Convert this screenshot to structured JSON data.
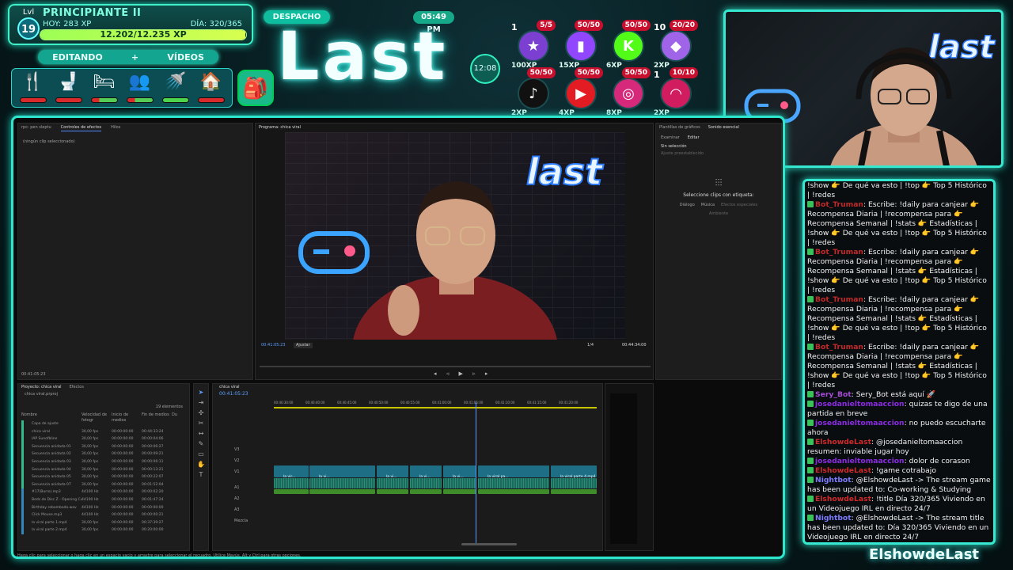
{
  "level": {
    "lvl_label": "Lvl",
    "lvl_value": "19",
    "rank": "PRINCIPIANTE II",
    "hoy": "HOY: 283 XP",
    "dia": "DÍA: 320/365",
    "xp": "12.202/12.235 XP",
    "xp_progress": 0.997
  },
  "mode": {
    "left": "EDITANDO",
    "sep": "+",
    "right": "VÍDEOS"
  },
  "needs": [
    {
      "icon": "fork-knife-icon",
      "glyph": "🍴",
      "level": "low"
    },
    {
      "icon": "toilet-icon",
      "glyph": "🚽",
      "level": "low"
    },
    {
      "icon": "bed-icon",
      "glyph": "🛏",
      "level": "mid"
    },
    {
      "icon": "people-icon",
      "glyph": "👥",
      "level": "mid"
    },
    {
      "icon": "shower-icon",
      "glyph": "🚿",
      "level": "full"
    },
    {
      "icon": "house-icon",
      "glyph": "🏠",
      "level": "low"
    }
  ],
  "title": {
    "despacho": "DESPACHO",
    "clock": "05:49 PM",
    "logo": "Last",
    "timer": "12:08"
  },
  "socials": [
    {
      "name": "star-icon",
      "glyph": "★",
      "count": "5/5",
      "index": "1",
      "xp": "100XP",
      "color": "#7b3fd1"
    },
    {
      "name": "twitch-icon",
      "glyph": "▮",
      "count": "50/50",
      "index": "",
      "xp": "15XP",
      "color": "#9146ff"
    },
    {
      "name": "kick-icon",
      "glyph": "K",
      "count": "50/50",
      "index": "",
      "xp": "6XP",
      "color": "#53fc18"
    },
    {
      "name": "ethereum-icon",
      "glyph": "◆",
      "count": "20/20",
      "index": "10",
      "xp": "2XP",
      "color": "#a064e8"
    },
    {
      "name": "tiktok-icon",
      "glyph": "♪",
      "count": "50/50",
      "index": "",
      "xp": "2XP",
      "color": "#111111"
    },
    {
      "name": "youtube-icon",
      "glyph": "▶",
      "count": "50/50",
      "index": "",
      "xp": "4XP",
      "color": "#e31b23"
    },
    {
      "name": "instagram-icon",
      "glyph": "◎",
      "count": "50/50",
      "index": "",
      "xp": "8XP",
      "color": "#d6297c"
    },
    {
      "name": "signal-icon",
      "glyph": "◠",
      "count": "10/10",
      "index": "1",
      "xp": "2XP",
      "color": "#d11d5f"
    }
  ],
  "editor": {
    "tabs_left": [
      "rpc: pen sleptu",
      "Controles de efectos",
      "Hilos"
    ],
    "no_clip": "(ningún clip seleccionado)",
    "left_time": "00:41:05:23",
    "program_tab": "Programa: chica viral",
    "program_time": "00:41:05:23",
    "fit": "Ajustar",
    "ratio": "1/4",
    "duration": "00:44:34:00",
    "right_tabs": [
      "Plantillas de gráficos",
      "Sonido esencial"
    ],
    "right_sub": [
      "Examinar",
      "Editar"
    ],
    "sin_seleccion": "Sin selección",
    "ajuste": "Ajuste preestablecido",
    "select_clips": "Seleccione clips con etiqueta:",
    "tags": [
      "Diálogo",
      "Música",
      "Efectos especiales"
    ],
    "ambiente": "Ambiente",
    "project_tabs": [
      "Proyecto: chica viral",
      "Efectos"
    ],
    "project_file": "chica viral.prproj",
    "items_count": "19 elementos",
    "columns": [
      "Nombre",
      "Velocidad de fotogr",
      "Inicio de medios",
      "Fin de medios",
      "Du"
    ],
    "rows": [
      [
        "Capa de ajuste",
        "",
        "",
        ""
      ],
      [
        "chica viral",
        "30,00 fps",
        "00:00:00:00",
        "00:44:33:24"
      ],
      [
        "IAP Sunofbline",
        "30,00 fps",
        "00:00:00:00",
        "00:00:04:06"
      ],
      [
        "Secuencia anidada 01",
        "30,00 fps",
        "00:00:00:00",
        "00:00:06:27"
      ],
      [
        "Secuencia anidada 02",
        "30,00 fps",
        "00:00:00:00",
        "00:00:09:21"
      ],
      [
        "Secuencia anidada 03",
        "30,00 fps",
        "00:00:00:00",
        "00:00:06:11"
      ],
      [
        "Secuencia anidada 04",
        "30,00 fps",
        "00:00:00:00",
        "00:00:13:21"
      ],
      [
        "Secuencia anidada 05",
        "30,00 fps",
        "00:00:00:00",
        "00:00:22:07"
      ],
      [
        "Secuencia anidada 07",
        "30,00 fps",
        "00:00:00:00",
        "00:01:52:04"
      ],
      [
        "#17(Burro).mp3",
        "44100 Hz",
        "00:00:00:00",
        "00:00:02:20"
      ],
      [
        "Beds de Disc Z - Opening Cut",
        "44100 Hz",
        "00:00:00:00",
        "00:01:47:24"
      ],
      [
        "Birthday rebombado.wav",
        "44100 Hz",
        "00:00:00:00",
        "00:00:00:00"
      ],
      [
        "Click Mouse.mp3",
        "44100 Hz",
        "00:00:00:00",
        "00:00:00:21"
      ],
      [
        "la viral parte 1.mp4",
        "30,00 fps",
        "00:00:00:00",
        "00:37:39:27"
      ],
      [
        "la viral parte 2.mp4",
        "30,00 fps",
        "00:00:00:00",
        "00:20:00:00"
      ]
    ],
    "seq_tab": "chica viral",
    "seq_time": "00:41:05:23",
    "ruler": [
      "00:40:30:00",
      "00:40:40:00",
      "00:40:45:00",
      "00:40:50:00",
      "00:40:55:00",
      "00:41:00:00",
      "00:41:05:00",
      "00:41:10:00",
      "00:41:15:00",
      "00:41:20:00"
    ],
    "track_labels": [
      "V3",
      "V2",
      "V1",
      "A1",
      "A2",
      "A3",
      "Mezcla"
    ],
    "clip_labels": [
      "la vir...",
      "la vi...",
      "la vi...",
      "la vi...",
      "la vi...",
      "la viral pa...",
      "la viral parte 4.mp4 [V]"
    ],
    "status": "Haga clic para seleccionar o haga clic en un espacio vacío y arrastre para seleccionar el recuadro. Utilice Mayús, Alt y Ctrl para otras opciones."
  },
  "chat": [
    {
      "user": "",
      "color": "#f1f1f1",
      "text": "!show 👉 De qué va esto | !top 👉 Top 5 Histórico | !redes"
    },
    {
      "user": "Bot_Truman",
      "color": "#c22a2a",
      "text": ": Escribe: !daily para canjear 👉 Recompensa Diaria | !recompensa para 👉 Recompensa Semanal | !stats 👉 Estadísticas | !show 👉 De qué va esto | !top 👉 Top 5 Histórico | !redes"
    },
    {
      "user": "Bot_Truman",
      "color": "#c22a2a",
      "text": ": Escribe: !daily para canjear 👉 Recompensa Diaria | !recompensa para 👉 Recompensa Semanal | !stats 👉 Estadísticas | !show 👉 De qué va esto | !top 👉 Top 5 Histórico | !redes"
    },
    {
      "user": "Bot_Truman",
      "color": "#c22a2a",
      "text": ": Escribe: !daily para canjear 👉 Recompensa Diaria | !recompensa para 👉 Recompensa Semanal | !stats 👉 Estadísticas | !show 👉 De qué va esto | !top 👉 Top 5 Histórico | !redes"
    },
    {
      "user": "Bot_Truman",
      "color": "#c22a2a",
      "text": ": Escribe: !daily para canjear 👉 Recompensa Diaria | !recompensa para 👉 Recompensa Semanal | !stats 👉 Estadísticas | !show 👉 De qué va esto | !top 👉 Top 5 Histórico | !redes"
    },
    {
      "user": "Sery_Bot",
      "color": "#a64ad8",
      "text": ": Sery_Bot está aquí 🚀"
    },
    {
      "user": "josedanieltomaaccion",
      "color": "#8a2be2",
      "text": ": quizas te digo de una partida en breve"
    },
    {
      "user": "josedanieltomaaccion",
      "color": "#8a2be2",
      "text": ": no puedo escucharte ahora"
    },
    {
      "user": "ElshowdeLast",
      "color": "#d02a2a",
      "text": ": @josedanieltomaaccion resumen: inviable jugar hoy"
    },
    {
      "user": "josedanieltomaaccion",
      "color": "#8a2be2",
      "text": ": dolor de corason"
    },
    {
      "user": "ElshowdeLast",
      "color": "#d02a2a",
      "text": ": !game cotrabajo"
    },
    {
      "user": "Nightbot",
      "color": "#7c7cff",
      "text": ": @ElshowdeLast -> The stream game has been updated to: Co-working & Studying"
    },
    {
      "user": "ElshowdeLast",
      "color": "#d02a2a",
      "text": ": !title Día 320/365 Viviendo en un Videojuego IRL en directo 24/7"
    },
    {
      "user": "Nightbot",
      "color": "#7c7cff",
      "text": ": @ElshowdeLast -> The stream title has been updated to: Día 320/365 Viviendo en un Videojuego IRL en directo 24/7"
    }
  ],
  "footer": "ElshowdeLast"
}
